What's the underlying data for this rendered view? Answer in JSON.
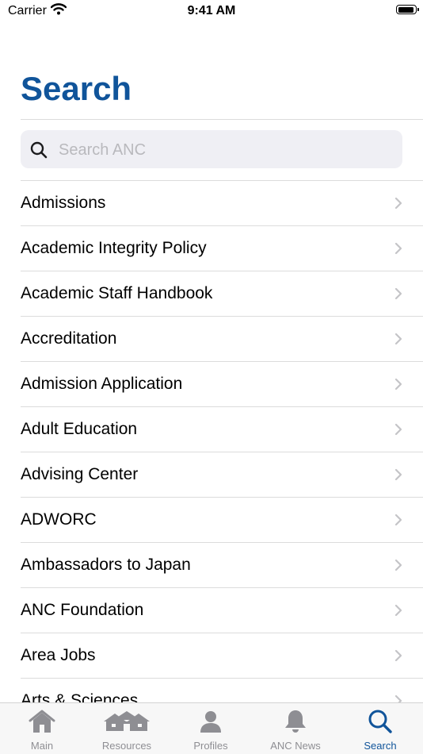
{
  "status_bar": {
    "carrier": "Carrier",
    "time": "9:41 AM"
  },
  "page": {
    "title": "Search"
  },
  "search": {
    "placeholder": "Search ANC",
    "value": ""
  },
  "items": [
    {
      "label": "Admissions"
    },
    {
      "label": "Academic Integrity Policy"
    },
    {
      "label": "Academic Staff Handbook"
    },
    {
      "label": "Accreditation"
    },
    {
      "label": "Admission Application"
    },
    {
      "label": "Adult Education"
    },
    {
      "label": "Advising Center"
    },
    {
      "label": "ADWORC"
    },
    {
      "label": "Ambassadors to Japan"
    },
    {
      "label": "ANC Foundation"
    },
    {
      "label": "Area Jobs"
    },
    {
      "label": "Arts & Sciences"
    }
  ],
  "tabs": [
    {
      "label": "Main",
      "icon": "house-icon"
    },
    {
      "label": "Resources",
      "icon": "buildings-icon"
    },
    {
      "label": "Profiles",
      "icon": "person-icon"
    },
    {
      "label": "ANC News",
      "icon": "bell-icon"
    },
    {
      "label": "Search",
      "icon": "magnifier-icon",
      "active": true
    }
  ],
  "colors": {
    "accent": "#10549a",
    "inactive": "#8e8e93"
  }
}
